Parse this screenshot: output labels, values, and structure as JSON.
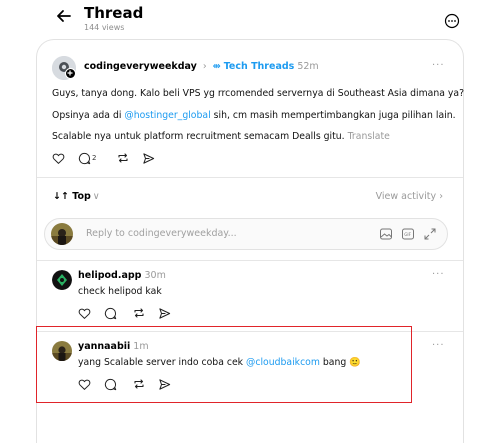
{
  "header": {
    "title": "Thread",
    "views": "144 views"
  },
  "post": {
    "username": "codingeveryweekday",
    "topic": "Tech Threads",
    "time": "52m",
    "line1": "Guys, tanya dong. Kalo beli VPS yg rrcomended servernya di Southeast Asia dimana ya?",
    "line2_before": "Opsinya ada di ",
    "line2_mention": "@hostinger_global",
    "line2_after": " sih, cm masih mempertimbangkan juga pilihan lain.",
    "line3": "Scalable nya untuk platform recruitment semacam Dealls gitu.",
    "translate": "Translate",
    "reply_count": "2"
  },
  "sort": {
    "label": "Top",
    "view_activity": "View activity"
  },
  "reply_box": {
    "placeholder": "Reply to codingeveryweekday..."
  },
  "replies": [
    {
      "username": "helipod.app",
      "time": "30m",
      "text": "check helipod kak"
    },
    {
      "username": "yannaabii",
      "time": "1m",
      "text_before": "yang Scalable server indo coba cek ",
      "mention": "@cloudbaikcom",
      "text_after": " bang ",
      "emoji": "🙂"
    }
  ],
  "colors": {
    "mention": "#1d9bf0",
    "highlight": "#e0242a"
  }
}
